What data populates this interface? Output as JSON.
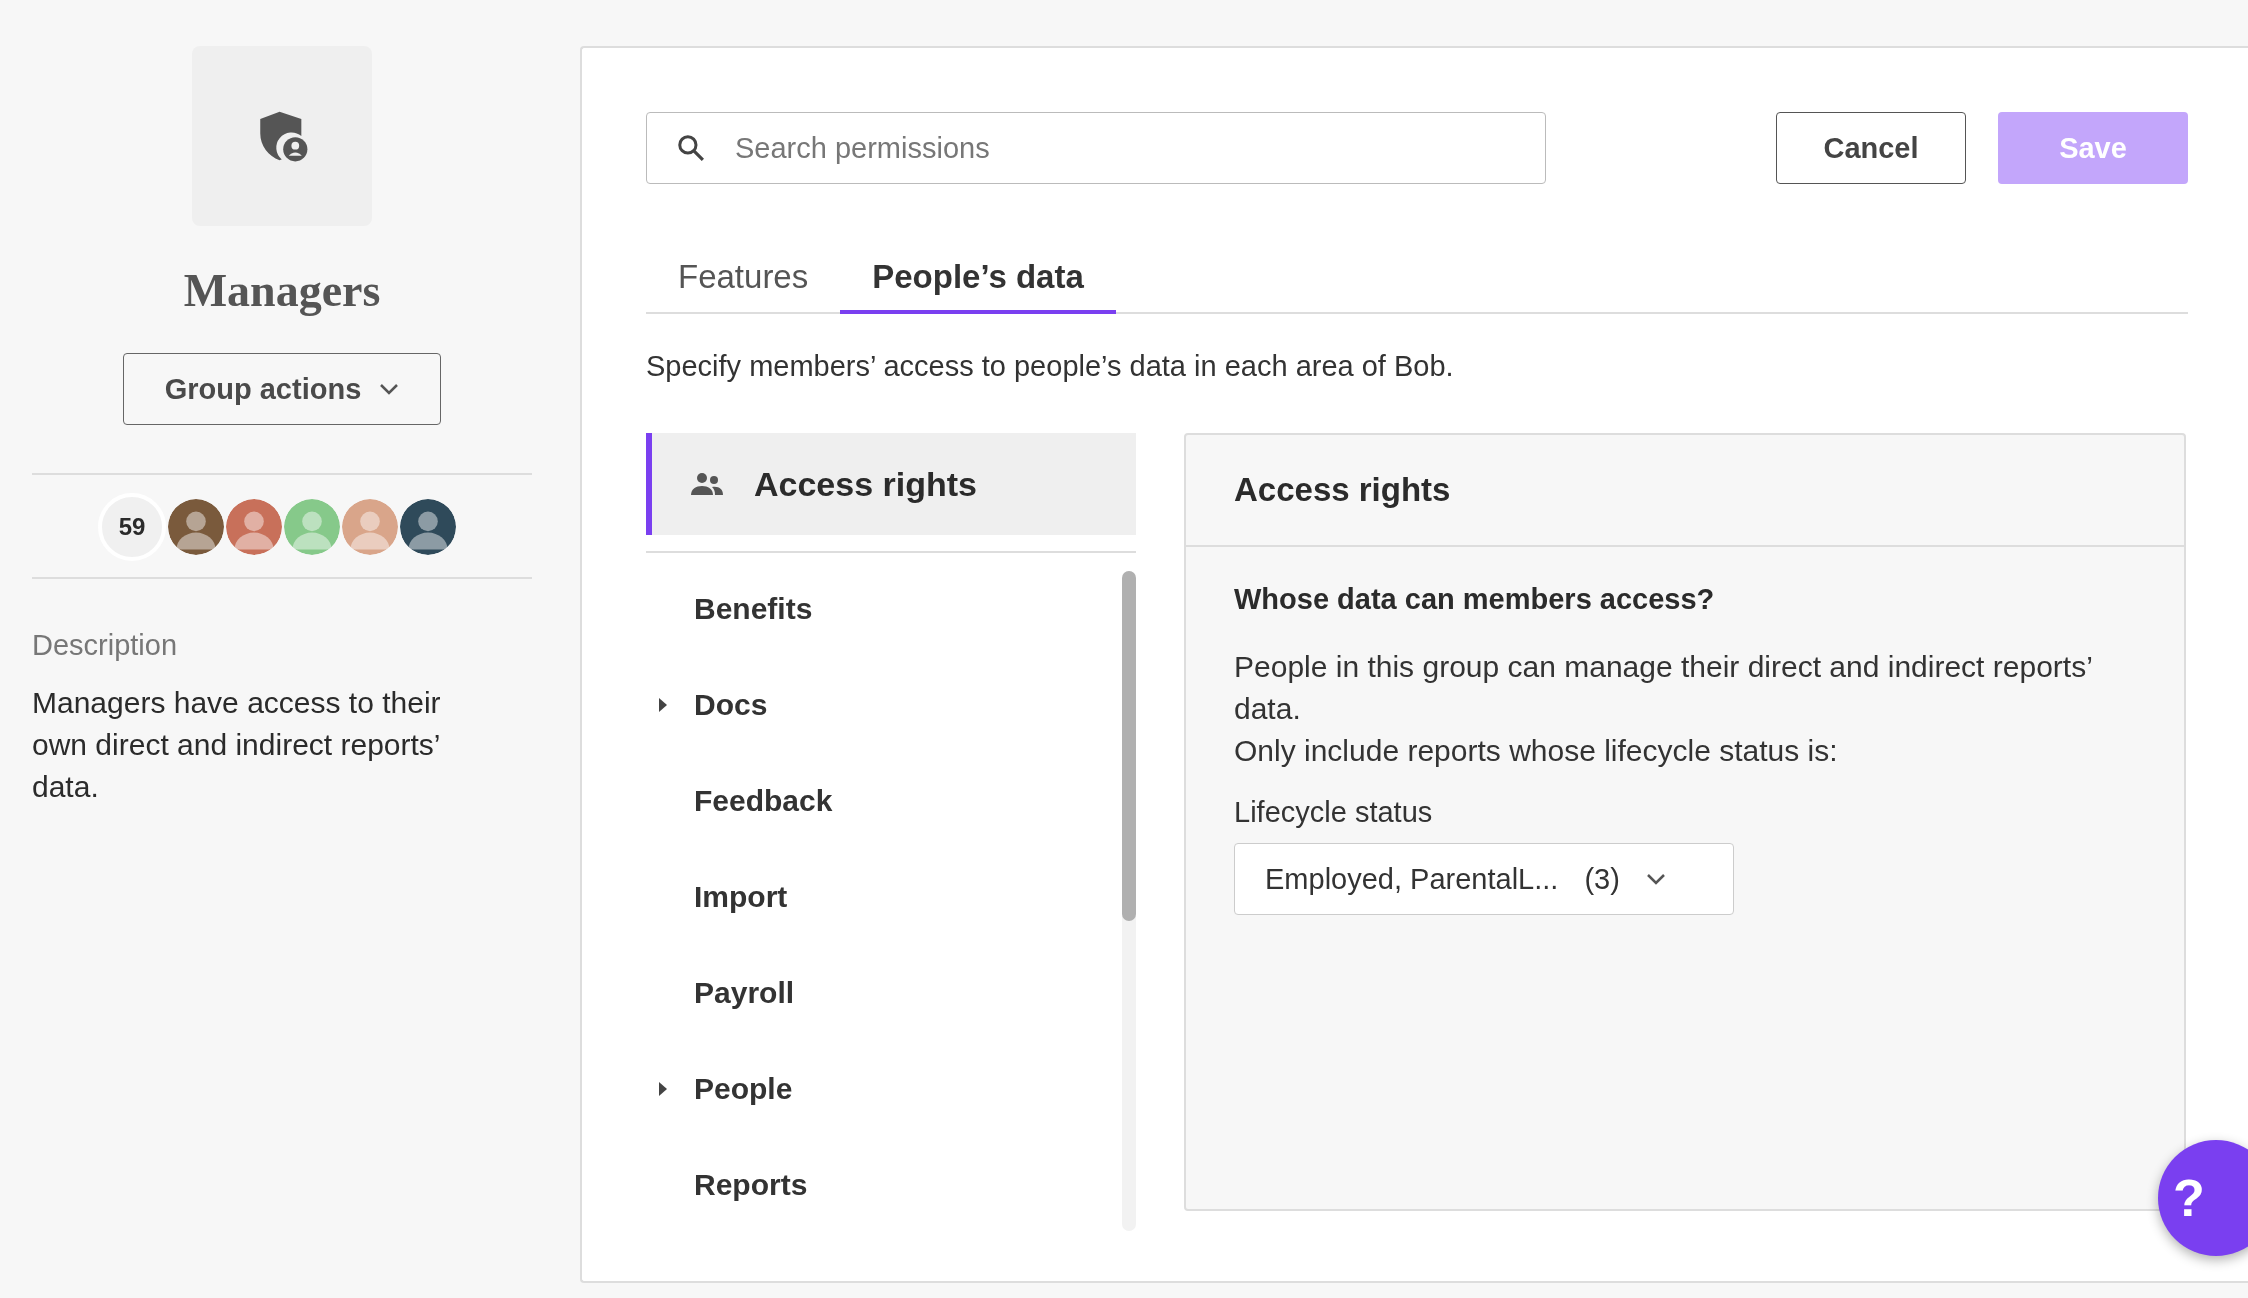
{
  "group": {
    "title": "Managers",
    "actions_button": "Group actions",
    "member_count": "59",
    "avatars": [
      {
        "color": "#7a5a3c"
      },
      {
        "color": "#c8705a"
      },
      {
        "color": "#86c98a"
      },
      {
        "color": "#d9a58a"
      },
      {
        "color": "#2f4a5a"
      }
    ],
    "description_label": "Description",
    "description": "Managers have access to their own direct and indirect reports’ data."
  },
  "search": {
    "placeholder": "Search permissions"
  },
  "buttons": [
    {
      "label": "Cancel",
      "kind": "secondary"
    },
    {
      "label": "Save",
      "kind": "primary",
      "disabled": true
    }
  ],
  "tabs": [
    {
      "label": "Features",
      "selected": false
    },
    {
      "label": "People’s data",
      "selected": true
    }
  ],
  "intro": "Specify members’ access to people’s data in each area of Bob.",
  "areas": [
    {
      "label": "Access rights",
      "selected": true,
      "expandable": false
    },
    {
      "label": "Benefits",
      "selected": false,
      "expandable": false
    },
    {
      "label": "Docs",
      "selected": false,
      "expandable": true
    },
    {
      "label": "Feedback",
      "selected": false,
      "expandable": false
    },
    {
      "label": "Import",
      "selected": false,
      "expandable": false
    },
    {
      "label": "Payroll",
      "selected": false,
      "expandable": false
    },
    {
      "label": "People",
      "selected": false,
      "expandable": true
    },
    {
      "label": "Reports",
      "selected": false,
      "expandable": false
    }
  ],
  "detail": {
    "title": "Access rights",
    "question": "Whose data can members access?",
    "lines": [
      "People in this group can manage their direct and indirect reports’ data.",
      "Only include reports whose lifecycle status is:"
    ],
    "field_label": "Lifecycle status",
    "field_value": "Employed, ParentalL...",
    "field_count": "(3)"
  },
  "help_button": "?"
}
